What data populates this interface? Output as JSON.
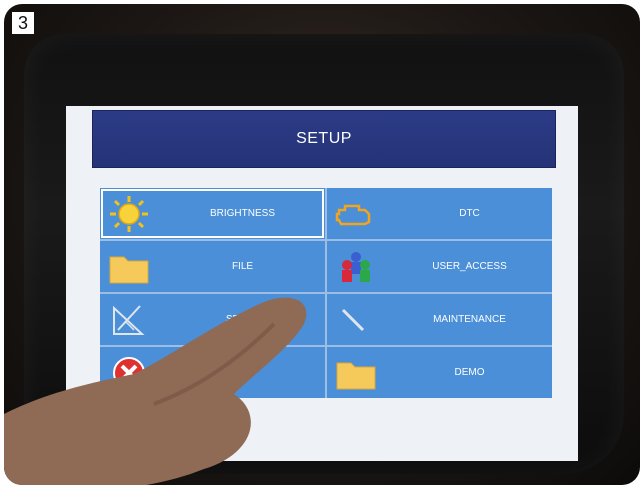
{
  "badge": "3",
  "screen": {
    "title": "SETUP"
  },
  "menu": {
    "items": [
      {
        "label": "BRIGHTNESS",
        "icon": "sun-icon"
      },
      {
        "label": "DTC",
        "icon": "engine-icon"
      },
      {
        "label": "FILE",
        "icon": "folder-icon"
      },
      {
        "label": "USER_ACCESS",
        "icon": "users-icon"
      },
      {
        "label": "SETUP",
        "icon": "setup-tools-icon"
      },
      {
        "label": "MAINTENANCE",
        "icon": "maintenance-icon"
      },
      {
        "label": "",
        "icon": "close-icon"
      },
      {
        "label": "DEMO",
        "icon": "folder-icon"
      }
    ]
  },
  "colors": {
    "title_bar": "#2c3b86",
    "menu_cell": "#4a8fd8",
    "screen_bg": "#eef2f7"
  }
}
